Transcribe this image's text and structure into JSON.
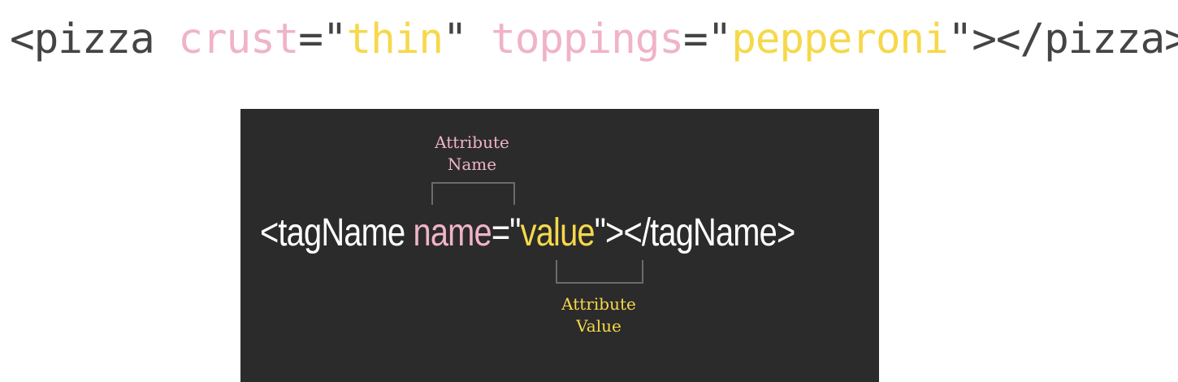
{
  "colors": {
    "base_text": "#444444",
    "attribute_name": "#f0b3c8",
    "attribute_value": "#f6d84a",
    "panel_background": "#2b2b2b"
  },
  "example_code": {
    "open": "<pizza",
    "attr1_name": "crust",
    "attr1_eq": "=\"",
    "attr1_value": "thin",
    "attr1_close": "\"",
    "attr2_name": "toppings",
    "attr2_eq": "=\"",
    "attr2_value": "pepperoni",
    "tail": "\"></pizza>"
  },
  "syntax": {
    "open": "<tagName",
    "attr_name": "name",
    "eq": "=\"",
    "attr_value": "value",
    "tail": "\"></tagName>"
  },
  "labels": {
    "name_line1": "Attribute",
    "name_line2": "Name",
    "value_line1": "Attribute",
    "value_line2": "Value"
  }
}
